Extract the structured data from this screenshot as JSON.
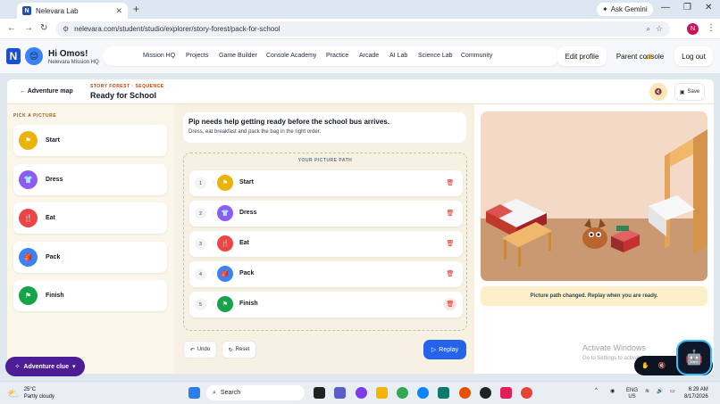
{
  "browser": {
    "tab_title": "Nelevara Lab",
    "url": "nelevara.com/student/studio/explorer/story-forest/pack-for-school",
    "ask_gemini": "Ask Gemini",
    "profile_letter": "N"
  },
  "header": {
    "logo": "N",
    "greeting": "Hi Omos!",
    "subtitle": "Nelevara Mission HQ",
    "nav": [
      "Mission HQ",
      "Projects",
      "Game Builder",
      "Console Academy",
      "Practice",
      "Arcade",
      "AI Lab",
      "Science Lab",
      "Community"
    ],
    "edit_profile": "Edit profile",
    "parent_console": "Parent console",
    "log_out": "Log out"
  },
  "subheader": {
    "back": "Adventure map",
    "kicker": "STORY FOREST · SEQUENCE",
    "title": "Ready for School",
    "save": "Save"
  },
  "picker": {
    "heading": "PICK A PICTURE",
    "items": [
      {
        "label": "Start",
        "color": "#eab308",
        "icon": "flag-icon"
      },
      {
        "label": "Dress",
        "color": "#8b5cf6",
        "icon": "shirt-icon"
      },
      {
        "label": "Eat",
        "color": "#ef4444",
        "icon": "fork-knife-icon"
      },
      {
        "label": "Pack",
        "color": "#3b82f6",
        "icon": "backpack-icon"
      },
      {
        "label": "Finish",
        "color": "#16a34a",
        "icon": "flag-icon"
      }
    ]
  },
  "instructions": {
    "title": "Pip needs help getting ready before the school bus arrives.",
    "subtitle": "Dress, eat breakfast and pack the bag in the right order."
  },
  "path": {
    "heading": "YOUR PICTURE PATH",
    "steps": [
      {
        "num": "1",
        "label": "Start",
        "color": "#eab308"
      },
      {
        "num": "2",
        "label": "Dress",
        "color": "#8b5cf6"
      },
      {
        "num": "3",
        "label": "Eat",
        "color": "#ef4444"
      },
      {
        "num": "4",
        "label": "Pack",
        "color": "#3b82f6"
      },
      {
        "num": "5",
        "label": "Finish",
        "color": "#16a34a"
      }
    ],
    "undo": "Undo",
    "reset": "Reset",
    "replay": "Replay"
  },
  "stage": {
    "status": "Picture path changed. Replay when you are ready."
  },
  "windows_watermark": {
    "line1": "Activate Windows",
    "line2": "Go to Settings to activate Windows."
  },
  "clue_button": "Adventure clue",
  "taskbar": {
    "temp": "25°C",
    "weather": "Partly cloudy",
    "search": "Search",
    "lang1": "ENG",
    "lang2": "US",
    "time": "6:29 AM",
    "date": "8/17/2026"
  }
}
